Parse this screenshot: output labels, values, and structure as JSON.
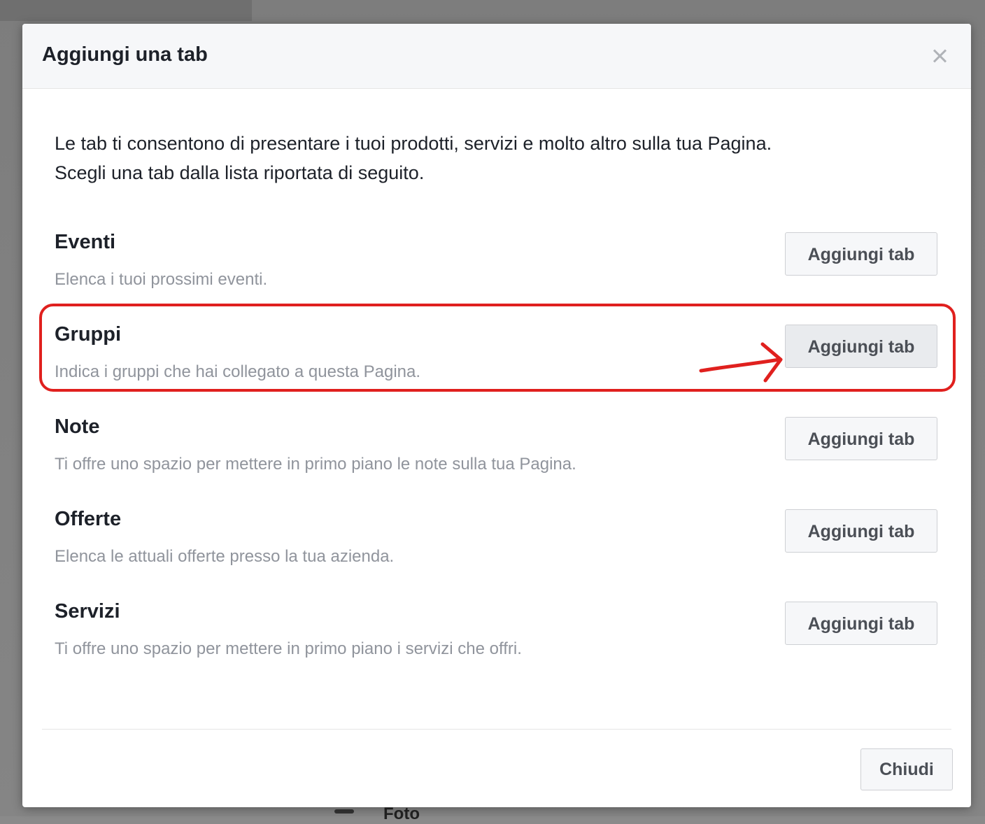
{
  "background": {
    "partial_text": "Foto"
  },
  "dialog": {
    "title": "Aggiungi una tab",
    "intro_line1": "Le tab ti consentono di presentare i tuoi prodotti, servizi e molto altro sulla tua Pagina.",
    "intro_line2": "Scegli una tab dalla lista riportata di seguito.",
    "tabs": [
      {
        "title": "Eventi",
        "description": "Elenca i tuoi prossimi eventi.",
        "button_label": "Aggiungi tab"
      },
      {
        "title": "Gruppi",
        "description": "Indica i gruppi che hai collegato a questa Pagina.",
        "button_label": "Aggiungi tab"
      },
      {
        "title": "Note",
        "description": "Ti offre uno spazio per mettere in primo piano le note sulla tua Pagina.",
        "button_label": "Aggiungi tab"
      },
      {
        "title": "Offerte",
        "description": "Elenca le attuali offerte presso la tua azienda.",
        "button_label": "Aggiungi tab"
      },
      {
        "title": "Servizi",
        "description": "Ti offre uno spazio per mettere in primo piano i servizi che offri.",
        "button_label": "Aggiungi tab"
      }
    ],
    "close_button_label": "Chiudi"
  },
  "annotation": {
    "highlight_color": "#e0201e",
    "highlighted_tab": "Gruppi"
  },
  "colors": {
    "title_text": "#1d2129",
    "secondary_text": "#90949c",
    "button_bg": "#f6f7f9",
    "button_border": "#ced0d4"
  }
}
